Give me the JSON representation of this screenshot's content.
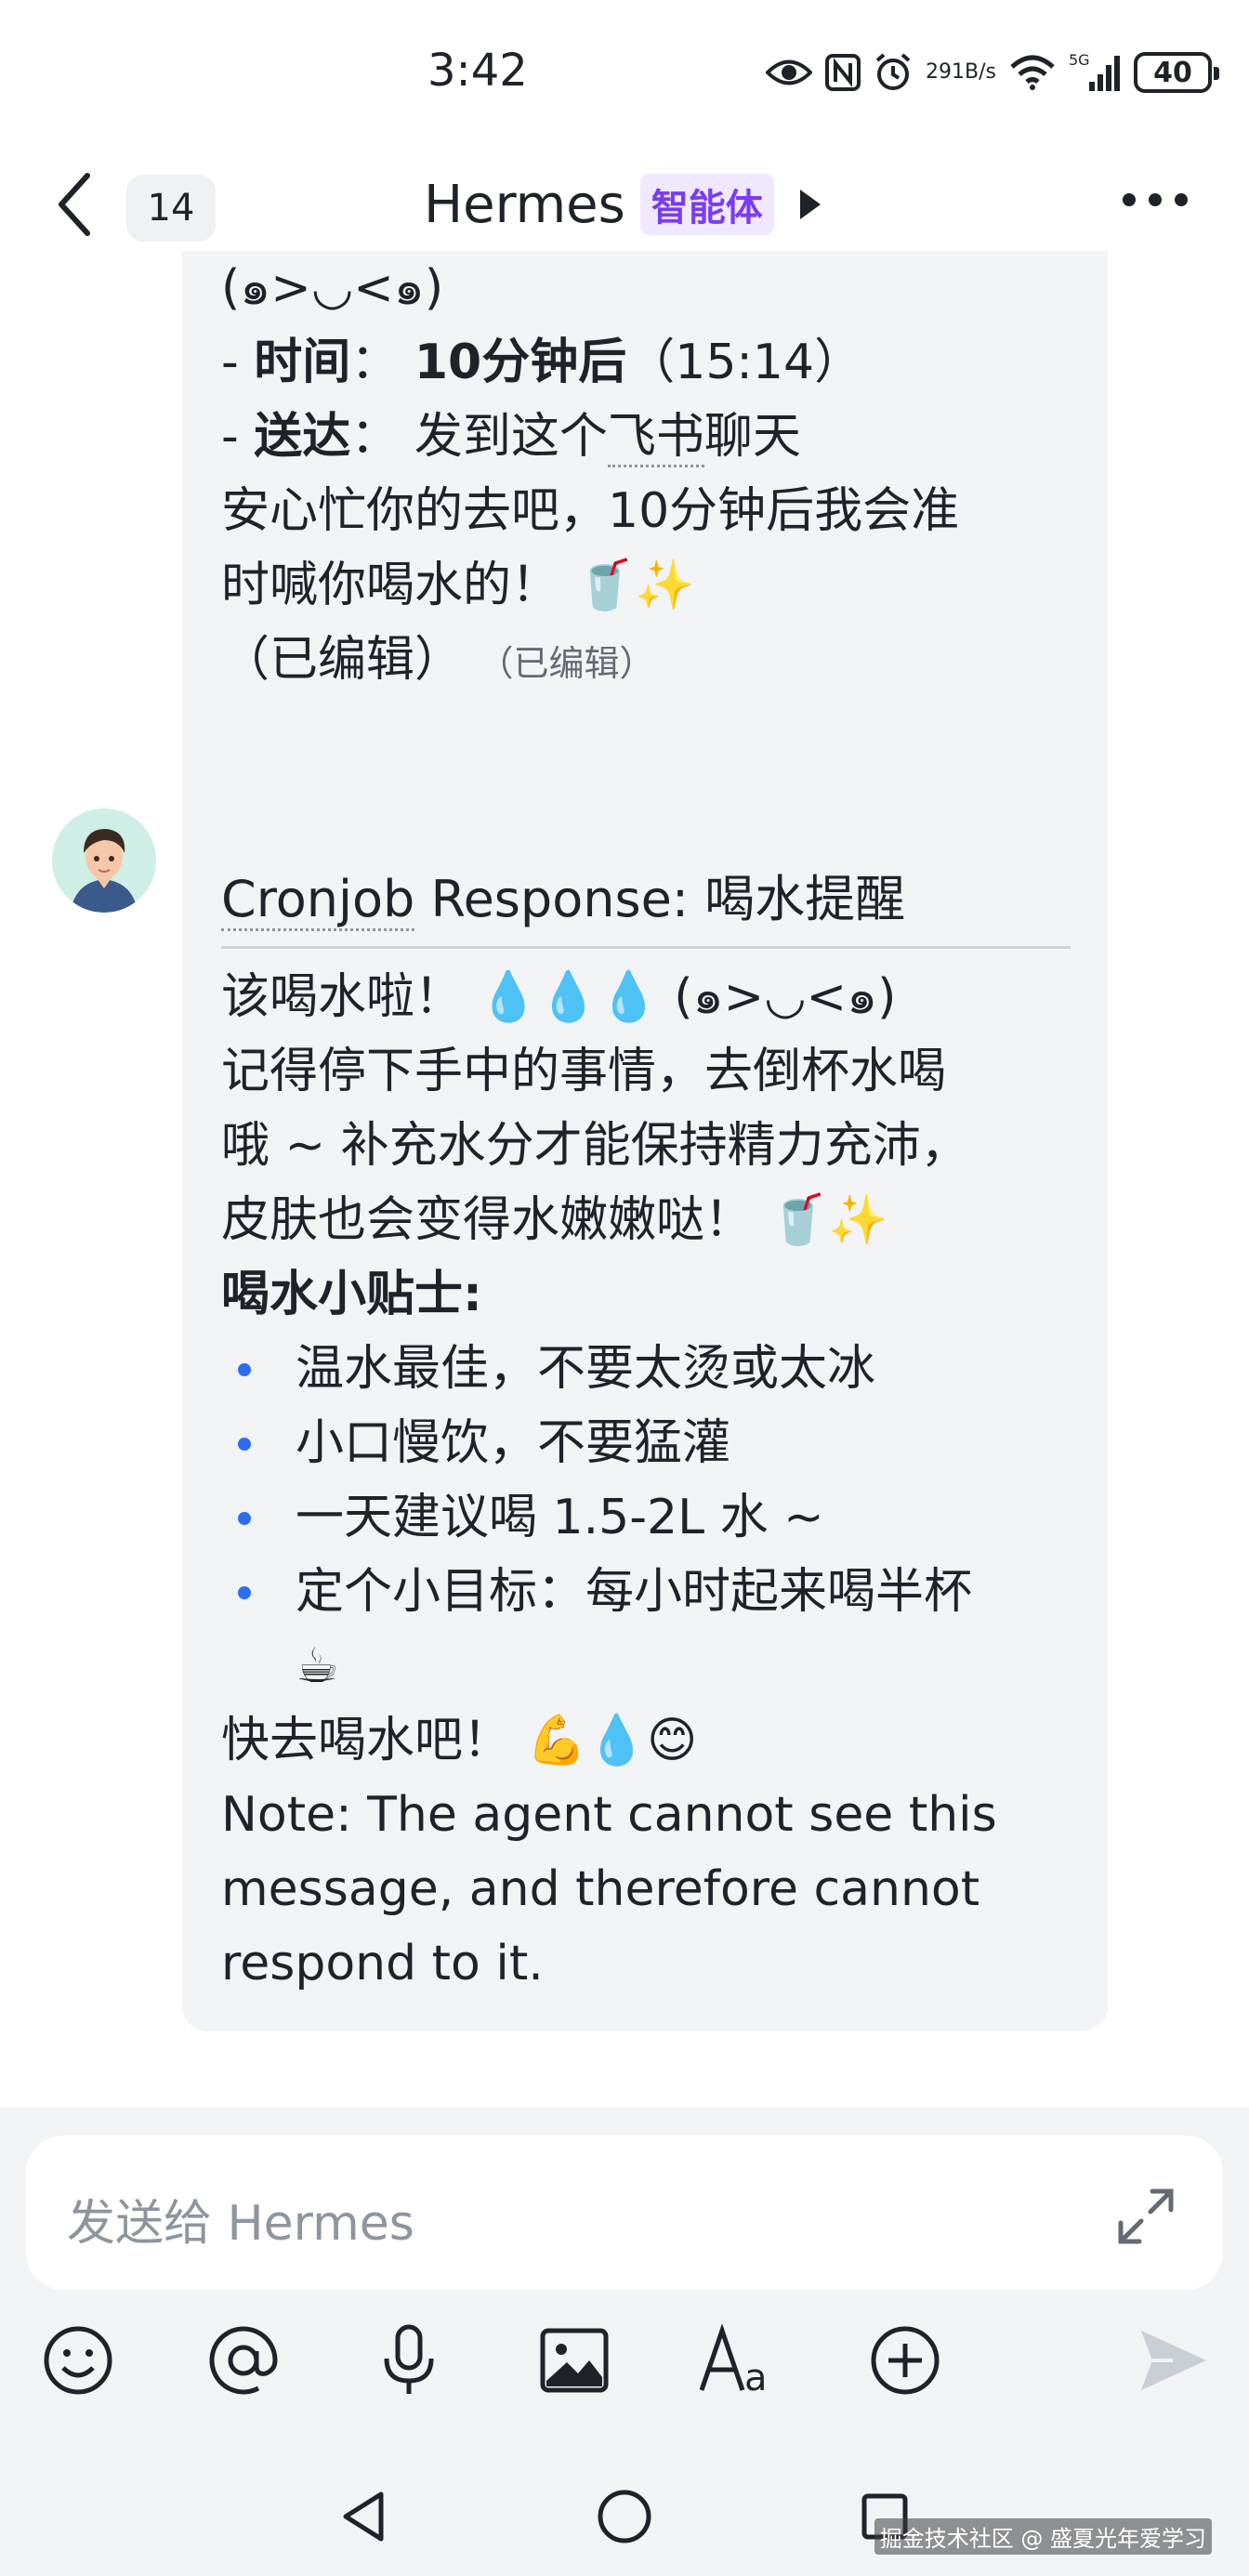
{
  "status_bar": {
    "time": "3:42",
    "net_speed_value": "291",
    "net_speed_unit": "B/s",
    "network": "5G",
    "battery": "40"
  },
  "header": {
    "unread_count": "14",
    "title": "Hermes",
    "agent_tag": "智能体"
  },
  "message1": {
    "lines": [
      "(๑>◡<๑)",
      "时间",
      "：",
      "10分钟后",
      "（15:14）",
      "送达",
      "：  发到这个",
      "飞书",
      "聊天",
      "安心忙你的去吧，10分钟后我会准",
      "时喊你喝水的！ 🥤✨",
      "（已编辑）",
      "（已编辑）"
    ]
  },
  "message2": {
    "title_prefix": "Cronjob",
    "title_rest": " Response: 喝水提醒",
    "lines": [
      "该喝水啦！ 💧💧💧 (๑>◡<๑)",
      "记得停下手中的事情，去倒杯水喝",
      "哦 ~ 补充水分才能保持精力充沛，",
      "皮肤也会变得水嫩嫩哒！ 🥤✨"
    ],
    "tips_heading": "喝水小贴士:",
    "tips": [
      "温水最佳，不要太烫或太冰",
      "小口慢饮，不要猛灌",
      "一天建议喝 1.5-2L 水 ~",
      "定个小目标：每小时起来喝半杯"
    ],
    "tip_tail": "☕",
    "closing": "快去喝水吧！ 💪💧😊",
    "note_lines": [
      "Note: The agent cannot see this",
      "message, and therefore cannot",
      "respond to it."
    ]
  },
  "composer": {
    "placeholder": "发送给 Hermes"
  },
  "watermark": "掘金技术社区 @ 盛夏光年爱学习",
  "colors": {
    "accent": "#7a3cf0",
    "agent_tag_bg": "#efe8ff",
    "bubble_bg": "#f2f3f5",
    "bullet": "#2d6ef0"
  },
  "icons": [
    "eye-icon",
    "nfc-icon",
    "alarm-icon",
    "wifi-icon",
    "signal-icon",
    "battery-icon",
    "back-icon",
    "play-icon",
    "more-icon",
    "avatar",
    "expand-icon",
    "emoji-icon",
    "mention-icon",
    "mic-icon",
    "image-icon",
    "font-icon",
    "plus-icon",
    "send-icon",
    "nav-back-icon",
    "nav-home-icon",
    "nav-recents-icon"
  ]
}
